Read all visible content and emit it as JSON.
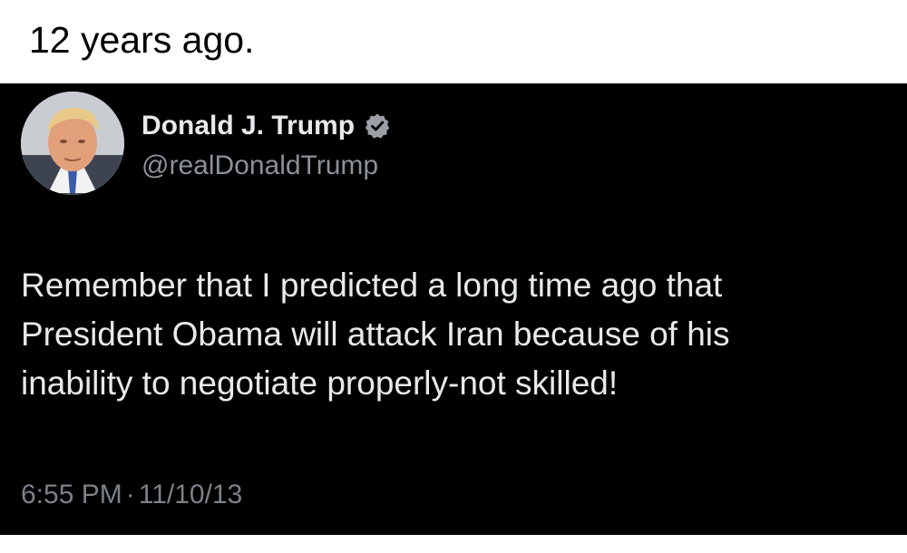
{
  "caption": "12 years ago.",
  "tweet": {
    "display_name": "Donald J. Trump",
    "handle": "@realDonaldTrump",
    "verified": true,
    "body_lines": [
      "Remember that I predicted a long time ago that",
      "President Obama will attack Iran because of his",
      "inability to negotiate properly-not skilled!"
    ],
    "time": "6:55 PM",
    "separator": "·",
    "date": "11/10/13"
  },
  "icons": {
    "avatar": "profile-photo",
    "verified": "verified-badge-icon"
  },
  "colors": {
    "tweet_background": "#000000",
    "primary_text": "#e7e9ea",
    "secondary_text": "#8b9198",
    "verified_badge": "#9aa0a6",
    "caption_text": "#000000"
  }
}
